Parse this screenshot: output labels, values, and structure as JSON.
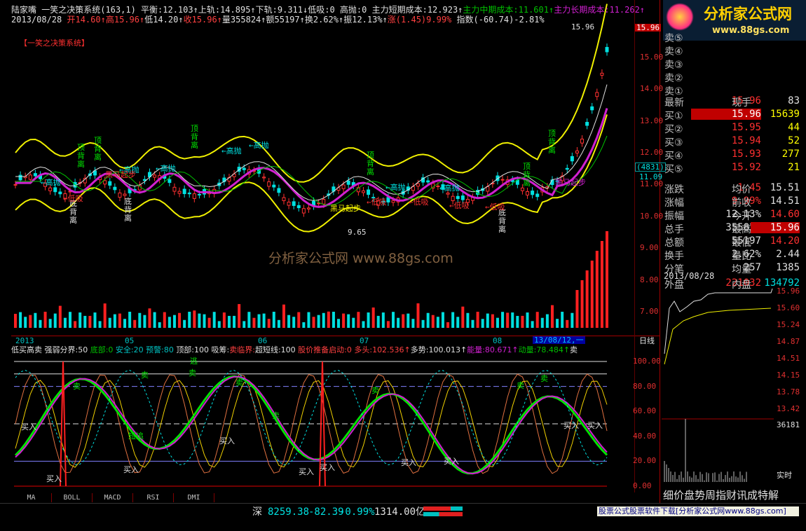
{
  "header": {
    "line1": [
      {
        "text": "陆家嘴  一笑之决策系统(163,1)",
        "color": "#e0e0e0"
      },
      {
        "text": " 平衡:12.103↑",
        "color": "#e0e0e0"
      },
      {
        "text": "上轨:14.895↑",
        "color": "#e0e0e0"
      },
      {
        "text": "下轨:9.311↓",
        "color": "#e0e0e0"
      },
      {
        "text": "低吸:0 高抛:0 ",
        "color": "#e0e0e0"
      },
      {
        "text": "主力短期成本:12.923↑",
        "color": "#e0e0e0"
      },
      {
        "text": "主力中期成本:11.601↑",
        "color": "#00c000"
      },
      {
        "text": "主力长期成本:11.262↑",
        "color": "#d020d0"
      }
    ],
    "line2": [
      {
        "text": "2013/08/28 ",
        "color": "#e0e0e0"
      },
      {
        "text": "开14.60↑",
        "color": "#ff4040"
      },
      {
        "text": "高15.96↑",
        "color": "#ff4040"
      },
      {
        "text": "低14.20↑",
        "color": "#e0e0e0"
      },
      {
        "text": "收15.96↑",
        "color": "#ff4040"
      },
      {
        "text": "量355824↑",
        "color": "#e0e0e0"
      },
      {
        "text": "额55197↑",
        "color": "#e0e0e0"
      },
      {
        "text": "换2.62%↑",
        "color": "#e0e0e0"
      },
      {
        "text": "振12.13%↑",
        "color": "#e0e0e0"
      },
      {
        "text": "涨(1.45)9.99%",
        "color": "#ff4040"
      },
      {
        "text": " 指数(-60.74)-2.81%",
        "color": "#e0e0e0"
      }
    ],
    "system_label": "【一笑之决策系统】",
    "watermark": "分析家公式网  www.88gs.com"
  },
  "chart_data": {
    "type": "candlestick",
    "symbol": "陆家嘴",
    "date": "2013/08/28",
    "price_axis": {
      "ticks": [
        "15.00",
        "14.00",
        "13.00",
        "12.00",
        "11.00",
        "10.00",
        "9.00",
        "8.00",
        "7.00"
      ],
      "top_label": "15.96",
      "current_box": "(4831)",
      "current_price": "11.09"
    },
    "max_label": "15.96",
    "min_label": "9.65",
    "x_labels": [
      "2013",
      "05",
      "06",
      "07",
      "08"
    ],
    "x_label_box": "13/08/12,一",
    "period": "日线",
    "annotations": [
      "顶背离",
      "顶背离",
      "顶背离",
      "顶背离",
      "顶背离",
      "顶背离",
      "底背离",
      "底背离",
      "底背离",
      "←高抛",
      "←高抛",
      "←高抛",
      "←高抛",
      "←高抛",
      "←高抛",
      "←高抛",
      "←低吸",
      "←低吸",
      "←低吸",
      "←低吸",
      "←低吸",
      "黑马起步",
      "黑马起步",
      "黑马起步"
    ],
    "indicator": {
      "title_parts": [
        {
          "text": "低买高卖 ",
          "color": "#e0e0e0"
        },
        {
          "text": "强弱分界:50 ",
          "color": "#e0e0e0"
        },
        {
          "text": "底部:0 ",
          "color": "#00c000"
        },
        {
          "text": "安全:20 ",
          "color": "#00c0c0"
        },
        {
          "text": "预警:80 ",
          "color": "#00c0c0"
        },
        {
          "text": "顶部:100 ",
          "color": "#e0e0e0"
        },
        {
          "text": "吸筹:",
          "color": "#e0e0e0"
        },
        {
          "text": "卖临界:",
          "color": "#ff4040"
        },
        {
          "text": "超短线:100 ",
          "color": "#e0e0e0"
        },
        {
          "text": "股价推备启动:0 ",
          "color": "#ff4040"
        },
        {
          "text": "多头:102.536↑",
          "color": "#ff4040"
        },
        {
          "text": "多势:100.013↑",
          "color": "#e0e0e0"
        },
        {
          "text": "能量:80.671↑",
          "color": "#d020d0"
        },
        {
          "text": "动量:78.484↑",
          "color": "#00c000"
        },
        {
          "text": "卖",
          "color": "#e0e0e0"
        }
      ],
      "ticks": [
        "100.00",
        "80.00",
        "60.00",
        "40.00",
        "20.00",
        "0.00"
      ],
      "labels": [
        "买入",
        "买入",
        "买入",
        "买入",
        "买入",
        "买入",
        "买入",
        "买入",
        "买入",
        "卖",
        "卖",
        "卖",
        "卖",
        "卖",
        "卖",
        "卖",
        "卖",
        "短追",
        "逃",
        "买入"
      ]
    }
  },
  "quote": {
    "sell_levels": [
      "卖⑤",
      "卖④",
      "卖③",
      "卖②",
      "卖①"
    ],
    "rows": [
      {
        "l1": "最新",
        "v1": "15.96",
        "l2": "现手",
        "v2": "83"
      },
      {
        "l1": "买①",
        "v1": "15.96",
        "l2": "",
        "v2": "15639"
      },
      {
        "l1": "买②",
        "v1": "15.95",
        "l2": "",
        "v2": "44"
      },
      {
        "l1": "买③",
        "v1": "15.94",
        "l2": "",
        "v2": "52"
      },
      {
        "l1": "买④",
        "v1": "15.93",
        "l2": "",
        "v2": "277"
      },
      {
        "l1": "买⑤",
        "v1": "15.92",
        "l2": "",
        "v2": "21"
      },
      {
        "l1": "涨跌",
        "v1": "1.45",
        "l2": "均价",
        "v2": "15.51"
      },
      {
        "l1": "涨幅",
        "v1": "9.99%",
        "l2": "前收",
        "v2": "14.51"
      },
      {
        "l1": "振幅",
        "v1": "12.13%",
        "l2": "今开",
        "v2": "14.60"
      },
      {
        "l1": "总手",
        "v1": "355824",
        "l2": "最高",
        "v2": "15.96"
      },
      {
        "l1": "总额",
        "v1": "55197",
        "l2": "最低",
        "v2": "14.20"
      },
      {
        "l1": "换手",
        "v1": "2.62%",
        "l2": "量比",
        "v2": "2.44"
      },
      {
        "l1": "分笔",
        "v1": "257",
        "l2": "均量",
        "v2": "1385"
      },
      {
        "l1": "外盘",
        "v1": "221032",
        "l2": "内盘",
        "v2": "134792"
      }
    ],
    "date": "2013/08/28",
    "mini_ticks": [
      "15.96",
      "15.60",
      "15.24",
      "14.87",
      "14.51",
      "14.15",
      "13.78",
      "13.42"
    ],
    "mini_volume_max": "36181",
    "mini_label": "实时",
    "bottom_tabs": "细价盘势周指财讯成特解"
  },
  "logo": {
    "text": "分析家公式网",
    "url": "www.88gs.com"
  },
  "tabs": [
    "MA",
    "BOLL",
    "MACD",
    "RSI",
    "DMI"
  ],
  "status": {
    "index_name": "深",
    "index_value": "8259.38",
    "index_change": "-82.39",
    "index_pct": "-0.99%",
    "amount": "1314.00亿",
    "ad_text": "股票公式股票软件下载[分析家公式网www.88gs.com]"
  }
}
